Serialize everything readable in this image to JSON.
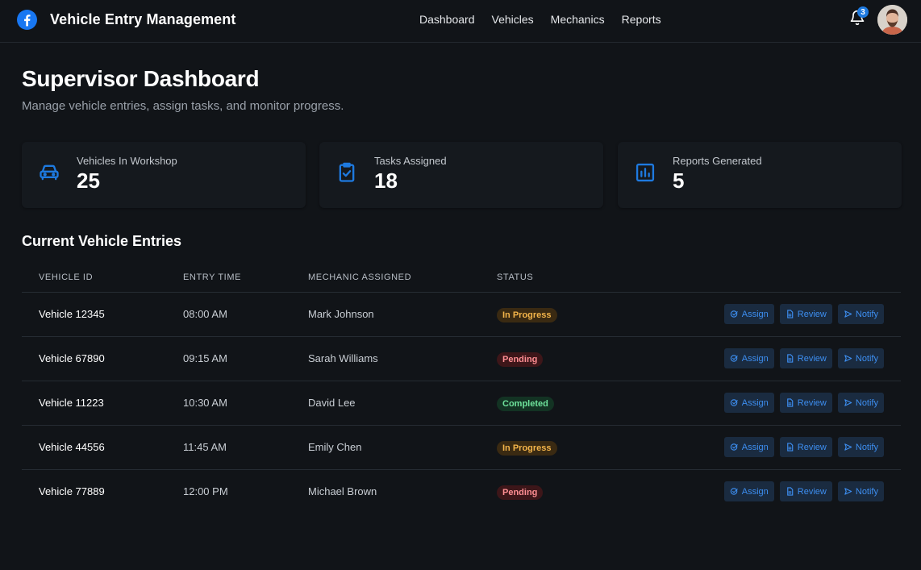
{
  "header": {
    "app_title": "Vehicle Entry Management",
    "nav": [
      "Dashboard",
      "Vehicles",
      "Mechanics",
      "Reports"
    ],
    "notification_count": "3",
    "brand_color": "#1877f2"
  },
  "page": {
    "title": "Supervisor Dashboard",
    "subtitle": "Manage vehicle entries, assign tasks, and monitor progress."
  },
  "stats": [
    {
      "label": "Vehicles In Workshop",
      "value": "25",
      "icon": "car-icon"
    },
    {
      "label": "Tasks Assigned",
      "value": "18",
      "icon": "task-check-icon"
    },
    {
      "label": "Reports Generated",
      "value": "5",
      "icon": "bar-chart-icon"
    }
  ],
  "section_title": "Current Vehicle Entries",
  "table": {
    "headers": [
      "VEHICLE ID",
      "ENTRY TIME",
      "MECHANIC ASSIGNED",
      "STATUS"
    ],
    "rows": [
      {
        "vehicle": "Vehicle 12345",
        "time": "08:00 AM",
        "mechanic": "Mark Johnson",
        "status": "In Progress"
      },
      {
        "vehicle": "Vehicle 67890",
        "time": "09:15 AM",
        "mechanic": "Sarah Williams",
        "status": "Pending"
      },
      {
        "vehicle": "Vehicle 11223",
        "time": "10:30 AM",
        "mechanic": "David Lee",
        "status": "Completed"
      },
      {
        "vehicle": "Vehicle 44556",
        "time": "11:45 AM",
        "mechanic": "Emily Chen",
        "status": "In Progress"
      },
      {
        "vehicle": "Vehicle 77889",
        "time": "12:00 PM",
        "mechanic": "Michael Brown",
        "status": "Pending"
      }
    ],
    "actions": [
      "Assign",
      "Review",
      "Notify"
    ]
  },
  "colors": {
    "accent": "#1e7ae0",
    "in_progress": "#f3b44a",
    "pending": "#ff8e93",
    "completed": "#6ee29b"
  }
}
